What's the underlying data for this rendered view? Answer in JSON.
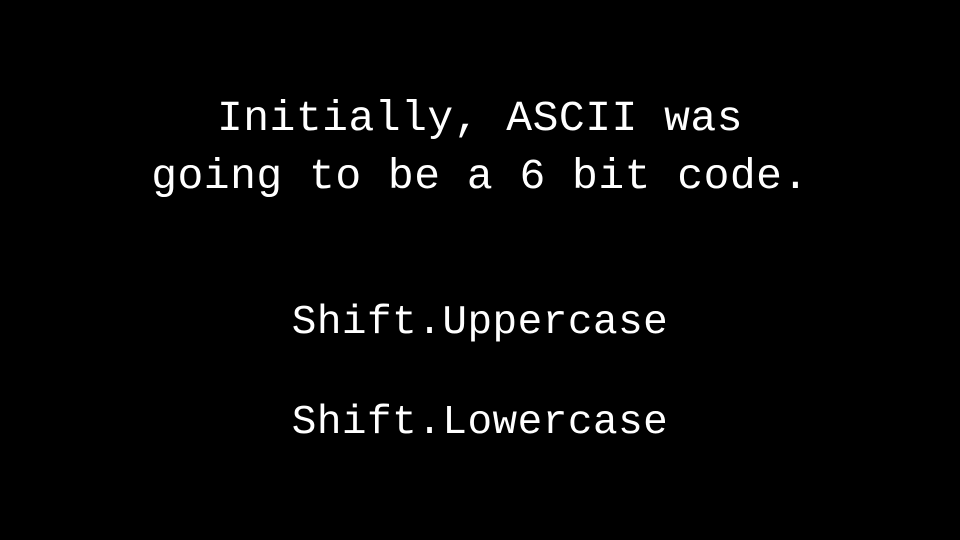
{
  "slide": {
    "heading_line1": "Initially, ASCII was",
    "heading_line2": "going to be a 6 bit code.",
    "item1": "Shift.Uppercase",
    "item2": "Shift.Lowercase"
  }
}
